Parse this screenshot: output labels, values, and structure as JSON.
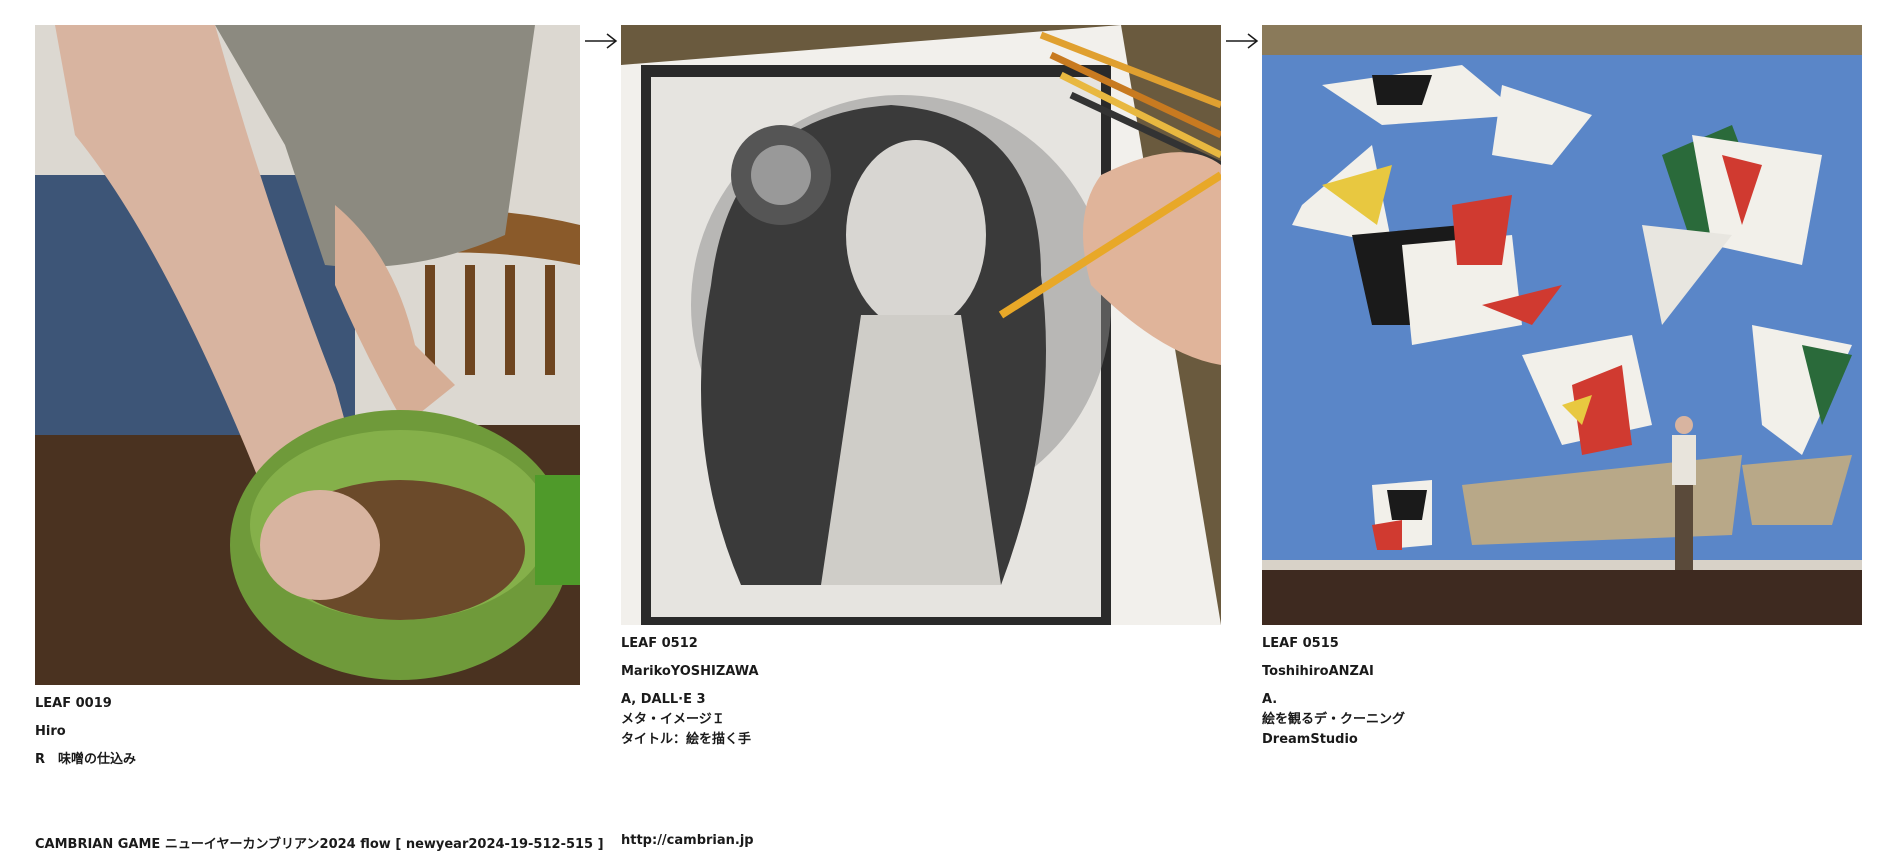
{
  "leaves": [
    {
      "id": "LEAF 0019",
      "author": "Hiro",
      "lines": [
        "R　味噌の仕込み"
      ]
    },
    {
      "id": "LEAF 0512",
      "author": "MarikoYOSHIZAWA",
      "lines": [
        "A, DALL·E 3",
        "メタ・イメージＩ",
        "タイトル：絵を描く手"
      ]
    },
    {
      "id": "LEAF 0515",
      "author": "ToshihiroANZAI",
      "lines": [
        "A.",
        "絵を観るデ・クーニング",
        "DreamStudio"
      ]
    }
  ],
  "footer": {
    "title": "CAMBRIAN GAME  ニューイヤーカンブリアン2024  flow [ newyear2024-19-512-515 ]",
    "url": "http://cambrian.jp"
  },
  "colors": {
    "text": "#1a1a1a",
    "background": "#ffffff"
  }
}
